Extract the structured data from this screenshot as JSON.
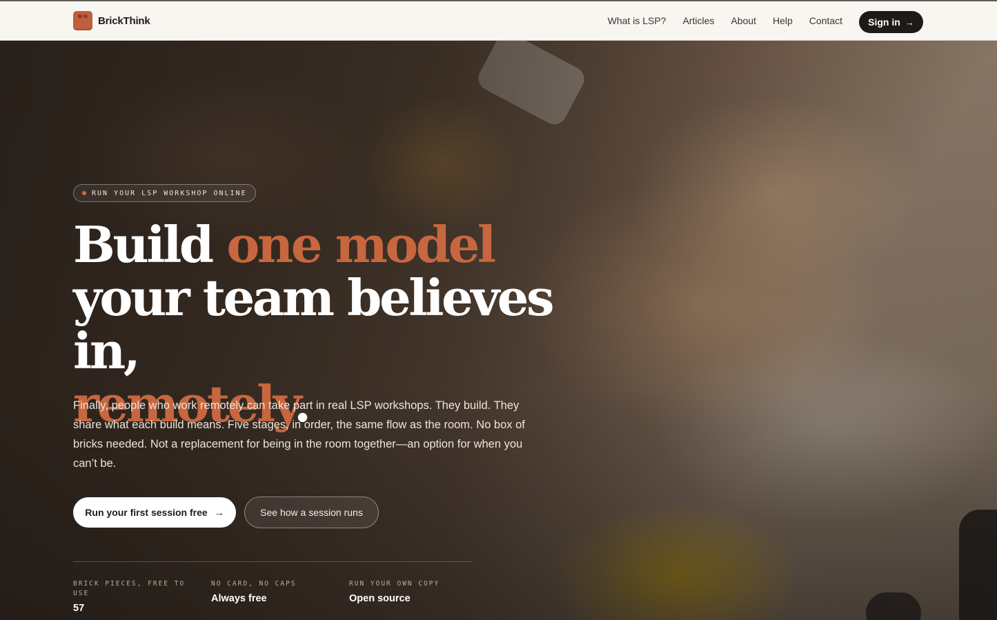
{
  "brand": {
    "name": "BrickThink",
    "accent_color": "#bf5f3e"
  },
  "nav": {
    "items": [
      {
        "label": "What is LSP?"
      },
      {
        "label": "Articles"
      },
      {
        "label": "About"
      },
      {
        "label": "Help"
      },
      {
        "label": "Contact"
      }
    ],
    "signin_label": "Sign in",
    "signin_icon": "arrow-right-icon"
  },
  "hero": {
    "eyebrow": "RUN YOUR LSP WORKSHOP ONLINE",
    "headline": {
      "part1": "Build ",
      "part2_accent": "one model",
      "part3": "your team believes in,",
      "part4_accent": "remotely",
      "part5": "."
    },
    "lede": "Finally, people who work remotely can take part in real LSP workshops. They build. They share what each build means. Five stages, in order, the same flow as the room. No box of bricks needed. Not a replacement for being in the room together—an option for when you can’t be.",
    "primary_cta": "Run your first session free",
    "secondary_cta": "See how a session runs",
    "stats": [
      {
        "label": "BRICK PIECES, FREE TO USE",
        "value": "57"
      },
      {
        "label": "NO CARD, NO CAPS",
        "value": "Always free"
      },
      {
        "label": "RUN YOUR OWN COPY",
        "value": "Open source"
      }
    ]
  }
}
